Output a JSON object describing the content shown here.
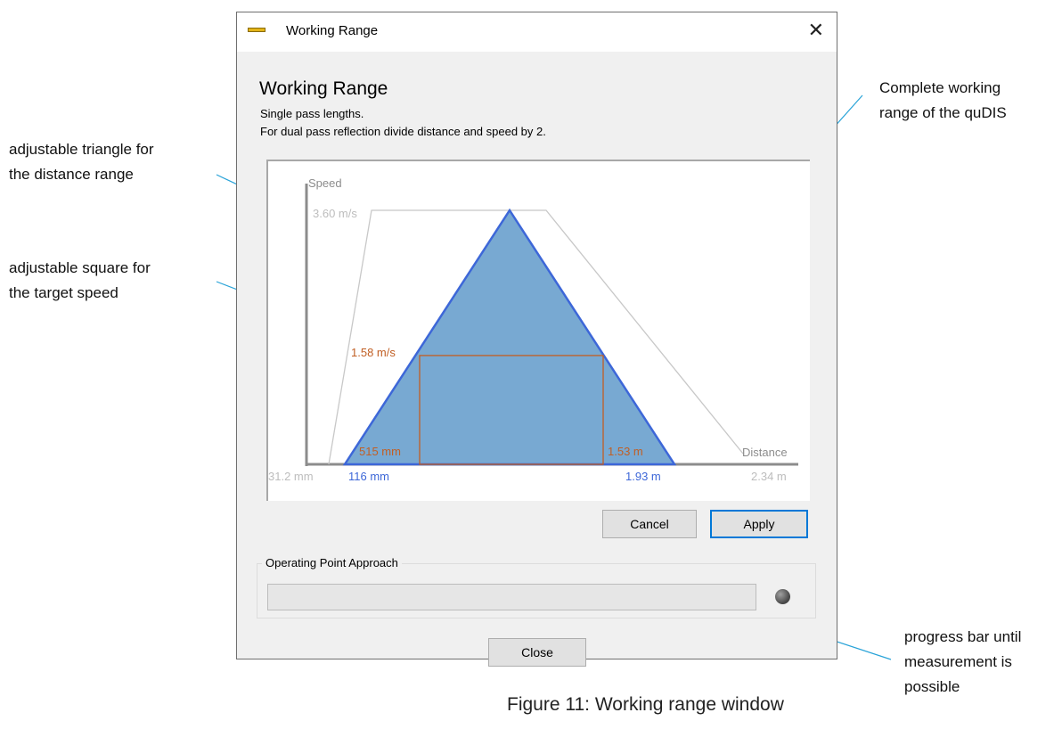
{
  "annotations": {
    "triangle": [
      "adjustable triangle for",
      "the distance range"
    ],
    "square": [
      "adjustable square for",
      "the target speed"
    ],
    "range": [
      "Complete working",
      "range of the quDIS"
    ],
    "progress": [
      "progress bar until",
      "measurement is",
      "possible"
    ]
  },
  "figure_caption": "Figure 11: Working range window",
  "window": {
    "title": "Working Range",
    "icon": "ruler-icon",
    "close_glyph": "✕"
  },
  "header": {
    "title": "Working Range",
    "line1": "Single pass lengths.",
    "line2": "For dual pass reflection divide distance and speed by 2."
  },
  "plot": {
    "axis_y_label": "Speed",
    "axis_x_label": "Distance",
    "max_speed_label": "3.60 m/s",
    "target_speed_label": "1.58 m/s",
    "min_distance_label": "31.2 mm",
    "max_distance_label": "2.34 m",
    "range_start_label": "116 mm",
    "range_end_label": "1.93 m",
    "square_start_label": "515 mm",
    "square_end_label": "1.53 m"
  },
  "chart_data": {
    "type": "area",
    "xlabel": "Distance",
    "ylabel": "Speed",
    "complete_range": {
      "min_distance_m": 0.0312,
      "max_distance_m": 2.34,
      "max_speed_mps": 3.6
    },
    "distance_triangle": {
      "start_m": 0.116,
      "end_m": 1.93,
      "peak_speed_mps": 3.6
    },
    "target_speed_square": {
      "speed_mps": 1.58,
      "start_m": 0.515,
      "end_m": 1.53
    }
  },
  "buttons": {
    "cancel": "Cancel",
    "apply": "Apply",
    "close": "Close"
  },
  "operating_point": {
    "group_label": "Operating Point Approach",
    "progress_fraction": 0,
    "status_icon": "status-led-icon"
  },
  "colors": {
    "triangle_fill": "#78a9d2",
    "triangle_edge": "#3d67d8",
    "square_edge": "#c15f24",
    "range_outline": "#c8c8c8",
    "apply_border": "#0078d7",
    "annotation_line": "#29a3d8"
  }
}
